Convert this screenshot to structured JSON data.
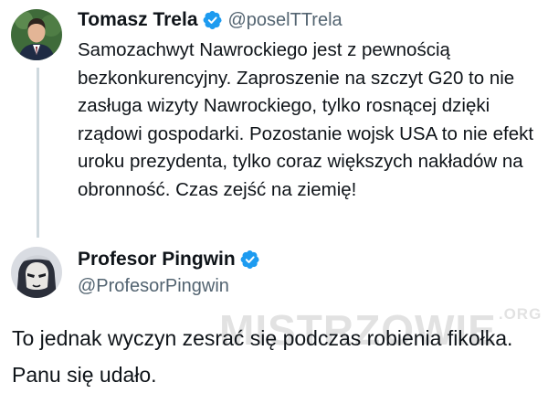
{
  "tweet": {
    "author_name": "Tomasz Trela",
    "author_handle": "@poselTTrela",
    "text": "Samozachwyt Nawrockiego jest z pewnością bezkonkurencyjny. Zaproszenie na szczyt G20 to nie zasługa wizyty Nawrockiego, tylko rosnącej dzięki rządowi gospodarki. Pozostanie wojsk USA to nie efekt uroku prezydenta, tylko coraz większych nakładów na obronność. Czas zejść na ziemię!",
    "verified_icon": "verified-badge-icon"
  },
  "reply": {
    "author_name": "Profesor Pingwin",
    "author_handle": "@ProfesorPingwin",
    "text": "To jednak wyczyn zesrać się podczas robienia fikołka. Panu się udało.",
    "verified_icon": "verified-badge-icon"
  },
  "watermark": {
    "text": "MISTRZOWIE",
    "tld": ".ORG"
  },
  "colors": {
    "verified_blue": "#1d9bf0",
    "handle_gray": "#536471",
    "thread_line": "#cfd9de"
  }
}
